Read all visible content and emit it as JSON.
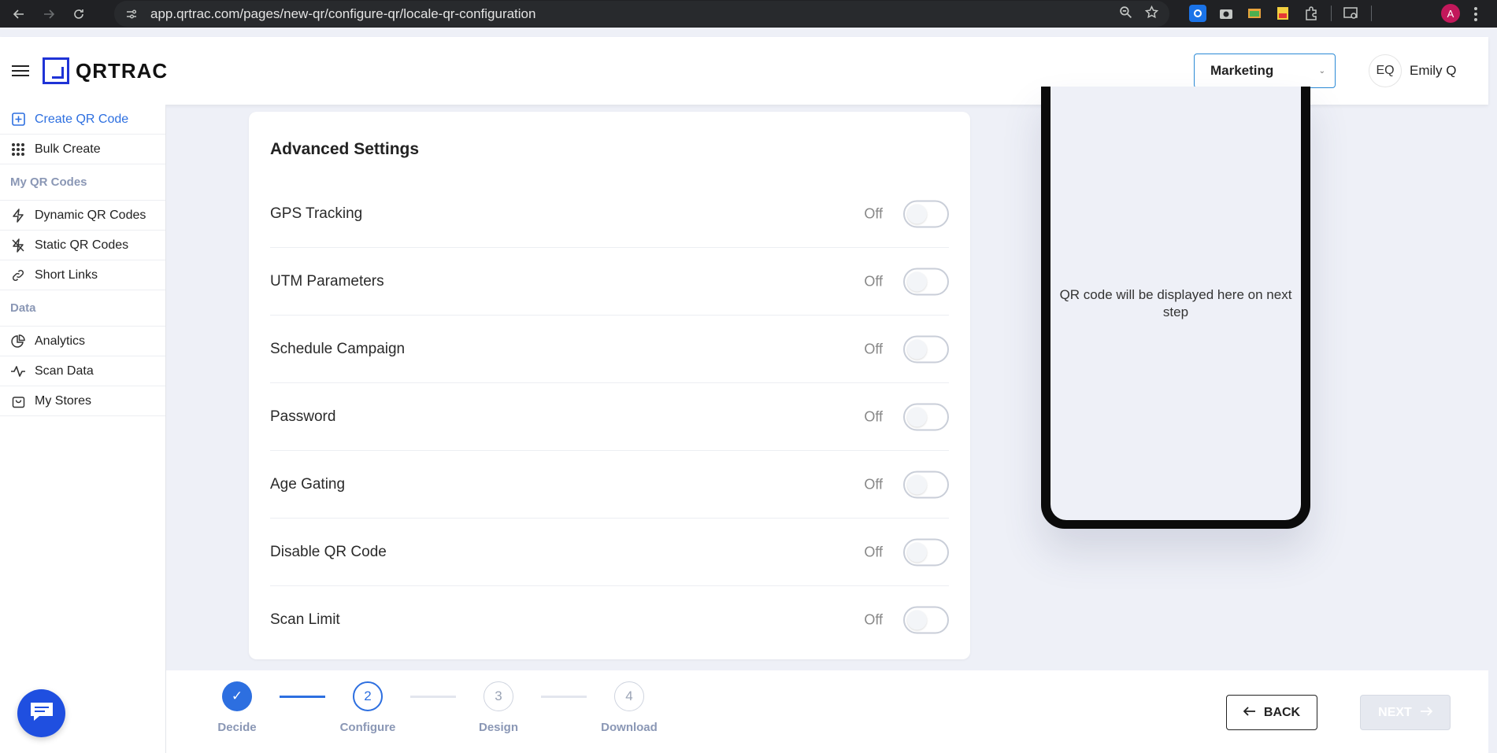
{
  "browser": {
    "url": "app.qrtrac.com/pages/new-qr/configure-qr/locale-qr-configuration",
    "profile_initial": "A"
  },
  "header": {
    "logo_text": "QRTRAC",
    "workspace": "Marketing",
    "user_initials": "EQ",
    "user_name": "Emily Q"
  },
  "sidebar": {
    "items_top": [
      {
        "label": "Create QR Code",
        "icon": "plus-square-icon",
        "active": true
      },
      {
        "label": "Bulk Create",
        "icon": "grid-dots-icon",
        "active": false
      }
    ],
    "section_my_qr": "My QR Codes",
    "items_my_qr": [
      {
        "label": "Dynamic QR Codes",
        "icon": "lightning-icon"
      },
      {
        "label": "Static QR Codes",
        "icon": "lightning-off-icon"
      },
      {
        "label": "Short Links",
        "icon": "link-icon"
      }
    ],
    "section_data": "Data",
    "items_data": [
      {
        "label": "Analytics",
        "icon": "pie-chart-icon"
      },
      {
        "label": "Scan Data",
        "icon": "activity-icon"
      },
      {
        "label": "My Stores",
        "icon": "shopping-bag-icon"
      }
    ]
  },
  "advanced": {
    "title": "Advanced Settings",
    "rows": [
      {
        "label": "GPS Tracking",
        "state": "Off"
      },
      {
        "label": "UTM Parameters",
        "state": "Off"
      },
      {
        "label": "Schedule Campaign",
        "state": "Off"
      },
      {
        "label": "Password",
        "state": "Off"
      },
      {
        "label": "Age Gating",
        "state": "Off"
      },
      {
        "label": "Disable QR Code",
        "state": "Off"
      },
      {
        "label": "Scan Limit",
        "state": "Off"
      }
    ]
  },
  "preview": {
    "message": "QR code will be displayed here on next step"
  },
  "stepper": {
    "steps": [
      {
        "number": "✓",
        "label": "Decide",
        "status": "done"
      },
      {
        "number": "2",
        "label": "Configure",
        "status": "current"
      },
      {
        "number": "3",
        "label": "Design",
        "status": "todo"
      },
      {
        "number": "4",
        "label": "Download",
        "status": "todo"
      }
    ],
    "back_label": "BACK",
    "next_label": "NEXT"
  }
}
